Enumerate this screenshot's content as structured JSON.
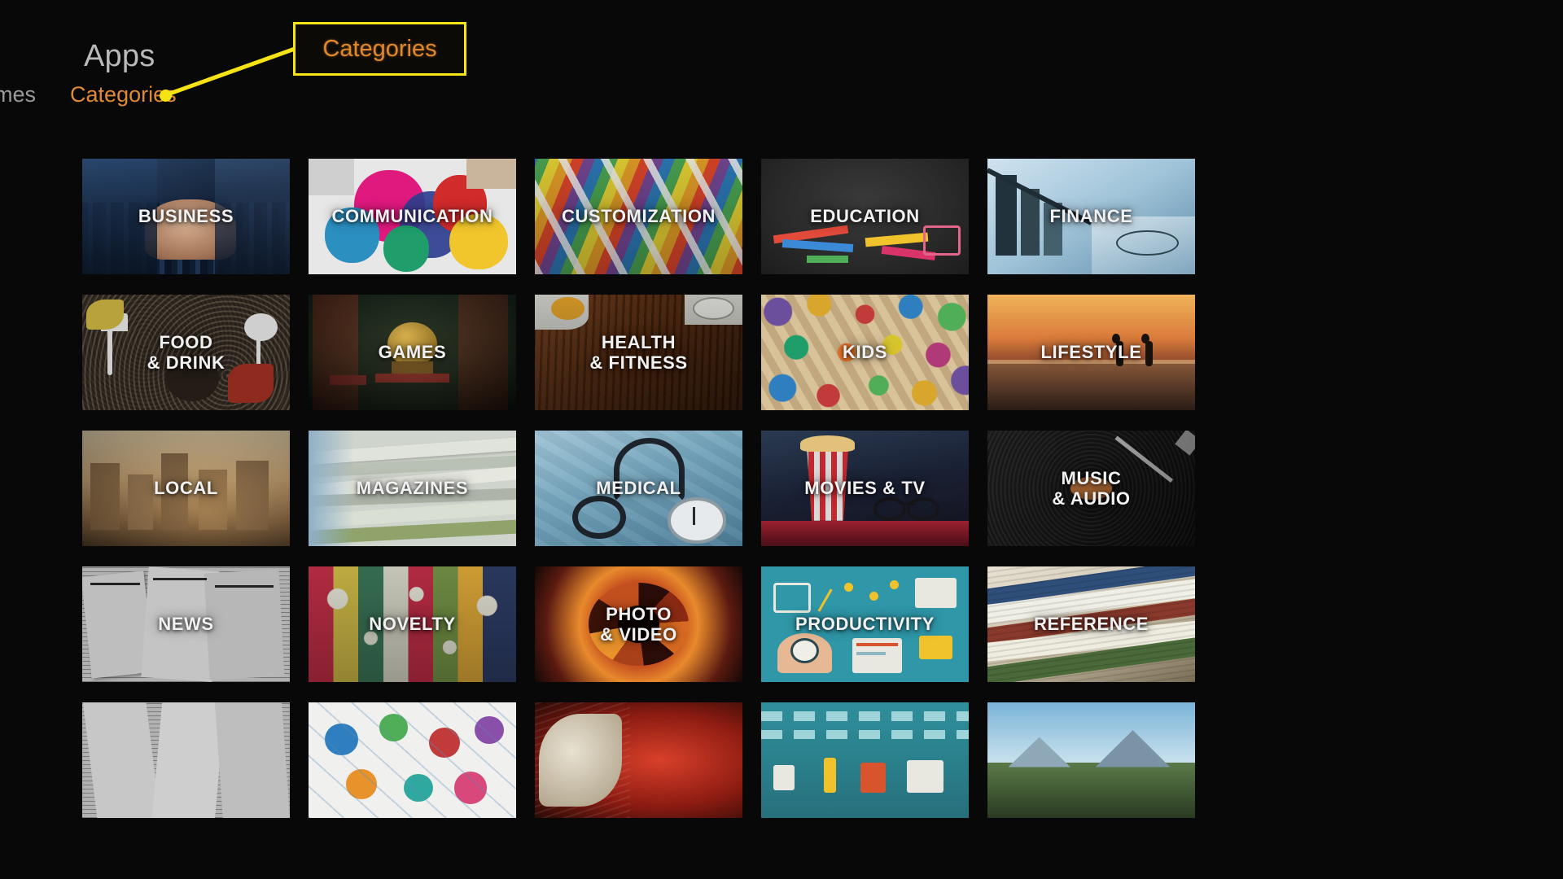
{
  "header": {
    "title": "Apps",
    "nav": [
      {
        "label": "Games",
        "active": false
      },
      {
        "label": "Categories",
        "active": true
      }
    ]
  },
  "annotation": {
    "callout_label": "Categories",
    "box_border_color": "#f5e316",
    "text_color": "#e0882f",
    "connector_color": "#f5e316"
  },
  "colors": {
    "background": "#080808",
    "title": "#b9b9b9",
    "nav_active": "#e08a35",
    "nav_inactive": "#9a9a9a",
    "tile_label": "#f1f1f1"
  },
  "grid": {
    "columns": 5,
    "tiles": [
      {
        "id": "business",
        "line1": "Business",
        "line2": "",
        "art": "business"
      },
      {
        "id": "communication",
        "line1": "Communication",
        "line2": "",
        "art": "communication"
      },
      {
        "id": "customization",
        "line1": "Customization",
        "line2": "",
        "art": "customization"
      },
      {
        "id": "education",
        "line1": "Education",
        "line2": "",
        "art": "education"
      },
      {
        "id": "finance",
        "line1": "Finance",
        "line2": "",
        "art": "finance"
      },
      {
        "id": "food-drink",
        "line1": "Food",
        "line2": "& Drink",
        "art": "food"
      },
      {
        "id": "games",
        "line1": "Games",
        "line2": "",
        "art": "games"
      },
      {
        "id": "health-fitness",
        "line1": "Health",
        "line2": "& Fitness",
        "art": "health"
      },
      {
        "id": "kids",
        "line1": "Kids",
        "line2": "",
        "art": "kids"
      },
      {
        "id": "lifestyle",
        "line1": "Lifestyle",
        "line2": "",
        "art": "lifestyle"
      },
      {
        "id": "local",
        "line1": "Local",
        "line2": "",
        "art": "local"
      },
      {
        "id": "magazines",
        "line1": "Magazines",
        "line2": "",
        "art": "magazines"
      },
      {
        "id": "medical",
        "line1": "Medical",
        "line2": "",
        "art": "medical"
      },
      {
        "id": "movies-tv",
        "line1": "Movies & TV",
        "line2": "",
        "art": "movies"
      },
      {
        "id": "music-audio",
        "line1": "Music",
        "line2": "& Audio",
        "art": "music"
      },
      {
        "id": "news",
        "line1": "News",
        "line2": "",
        "art": "news"
      },
      {
        "id": "novelty",
        "line1": "Novelty",
        "line2": "",
        "art": "novelty"
      },
      {
        "id": "photo-video",
        "line1": "Photo",
        "line2": "& Video",
        "art": "photo"
      },
      {
        "id": "productivity",
        "line1": "Productivity",
        "line2": "",
        "art": "productivity"
      },
      {
        "id": "reference",
        "line1": "Reference",
        "line2": "",
        "art": "reference"
      },
      {
        "id": "row5-1",
        "line1": "",
        "line2": "",
        "art": "news2"
      },
      {
        "id": "row5-2",
        "line1": "",
        "line2": "",
        "art": "social"
      },
      {
        "id": "row5-3",
        "line1": "",
        "line2": "",
        "art": "shopping"
      },
      {
        "id": "row5-4",
        "line1": "",
        "line2": "",
        "art": "sports"
      },
      {
        "id": "row5-5",
        "line1": "",
        "line2": "",
        "art": "travel"
      }
    ]
  }
}
